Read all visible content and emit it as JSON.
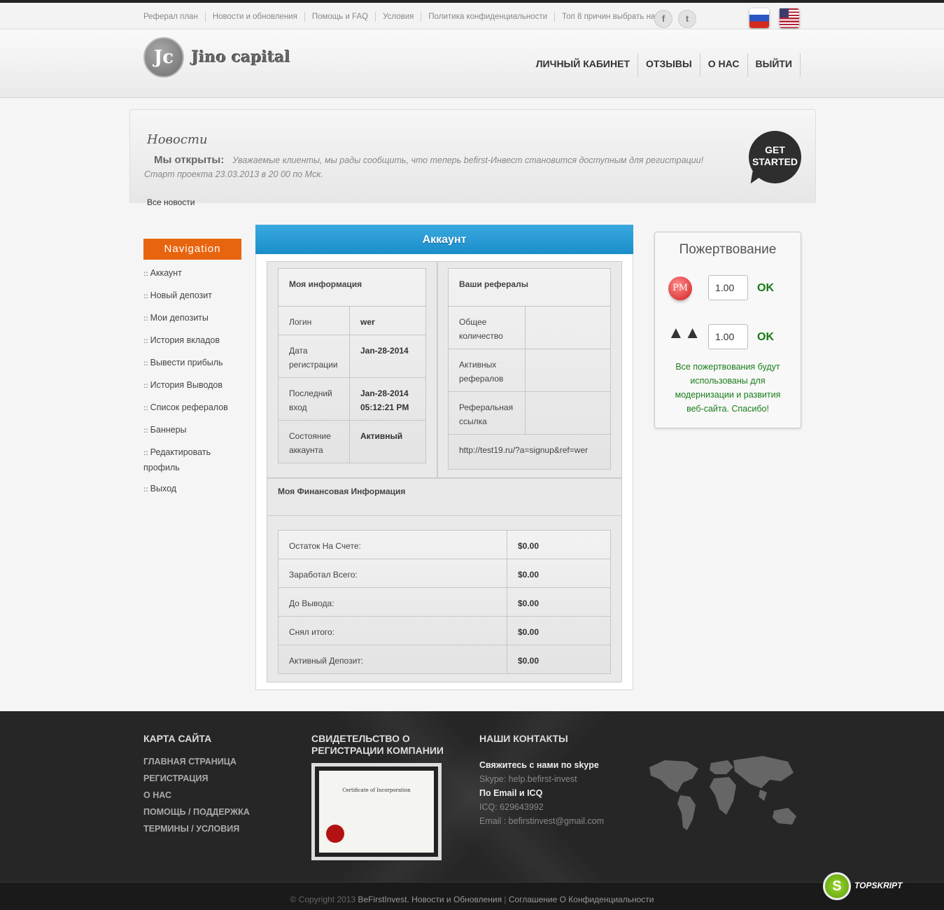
{
  "topbar": {
    "links": [
      "Реферал план",
      "Новости и обновления",
      "Помощь и FAQ",
      "Условия",
      "Политика конфиденциальности",
      "Топ 8 причин выбрать нас"
    ]
  },
  "header": {
    "logo_mark": "Jc",
    "logo_text": "Jino capital",
    "nav": [
      "ЛИЧНЫЙ КАБИНЕТ",
      "ОТЗЫВЫ",
      "О НАС",
      "ВЫЙТИ"
    ]
  },
  "news": {
    "title": "Новости",
    "headline": "Мы открыты:",
    "text": "Уважаемые клиенты, мы рады сообщить, что теперь befirst-Инвест становится доступным для регистрации!",
    "text2": "Старт проекта 23.03.2013 в 20 00 по Мск.",
    "all_news": "Все новости",
    "get_started_1": "GET",
    "get_started_2": "STARTED"
  },
  "sidebar": {
    "title": "Navigation",
    "items": [
      "Аккаунт",
      "Новый депозит",
      "Мои депозиты",
      "История вкладов",
      "Вывести прибыль",
      "История Выводов",
      "Список рефералов",
      "Баннеры",
      "Редактировать профиль",
      "Выход"
    ]
  },
  "account": {
    "title": "Аккаунт",
    "my_info": {
      "title": "Моя информация",
      "rows": [
        {
          "label": "Логин",
          "value": "wer"
        },
        {
          "label": "Дата регистрации",
          "value": "Jan-28-2014"
        },
        {
          "label": "Последний вход",
          "value": "Jan-28-2014 05:12:21 PM"
        },
        {
          "label": "Состояние аккаунта",
          "value": "Активный"
        }
      ]
    },
    "referrals": {
      "title": "Ваши рефералы",
      "rows": [
        {
          "label": "Общее количество",
          "value": ""
        },
        {
          "label": "Активных рефералов",
          "value": ""
        },
        {
          "label": "Реферальная ссылка",
          "value": ""
        }
      ],
      "link": "http://test19.ru/?a=signup&ref=wer"
    },
    "finance": {
      "title": "Моя Финансовая Информация",
      "rows": [
        {
          "label": "Остаток На Счете:",
          "value": "$0.00"
        },
        {
          "label": "Заработал Всего:",
          "value": "$0.00"
        },
        {
          "label": "До Вывода:",
          "value": "$0.00"
        },
        {
          "label": "Снял итого:",
          "value": "$0.00"
        },
        {
          "label": "Активный Депозит:",
          "value": "$0.00"
        }
      ]
    }
  },
  "donation": {
    "title": "Пожертвование",
    "pm_label": "PM",
    "amount1": "1.00",
    "amount2": "1.00",
    "ok": "OK",
    "note": "Все пожертвования будут использованы для модернизации и развития веб-сайта. Спасибо!"
  },
  "footer": {
    "sitemap_title": "КАРТА САЙТА",
    "sitemap": [
      "ГЛАВНАЯ СТРАНИЦА",
      "РЕГИСТРАЦИЯ",
      "О НАС",
      "ПОМОЩЬ / ПОДДЕРЖКА",
      "ТЕРМИНЫ / УСЛОВИЯ"
    ],
    "cert_title": "СВИДЕТЕЛЬСТВО О РЕГИСТРАЦИИ КОМПАНИИ",
    "cert_text": "Certificate of Incorporation",
    "contacts_title": "НАШИ КОНТАКТЫ",
    "skype_head": "Свяжитесь с нами по skype",
    "skype": "Skype: help.befirst-invest",
    "email_head": "По Email и ICQ",
    "icq": "ICQ: 629643992",
    "email": "Email : befirstinvest@gmail.com"
  },
  "copyright": {
    "prefix": "© Copyright 2013",
    "brand": "BeFirstInvest.",
    "news": "Новости и Обновления",
    "sep": "|",
    "privacy": "Соглашение О Конфиденциальности"
  },
  "badge": {
    "letter": "S",
    "text": "TOPSKRIPT"
  }
}
